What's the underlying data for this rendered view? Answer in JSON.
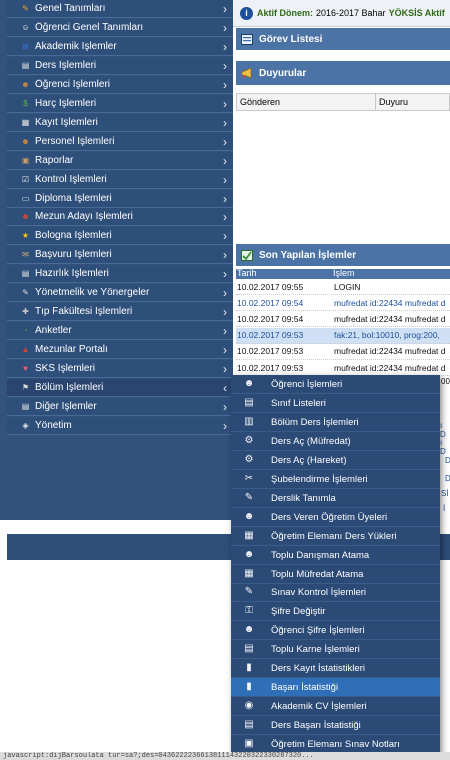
{
  "info_bar": {
    "label": "Aktif Dönem:",
    "value": "2016-2017 Bahar",
    "yoksis": "YÖKSİS Aktif",
    "icon": "info-icon"
  },
  "panels": {
    "gorev": {
      "title": "Görev Listesi",
      "icon": "task-list-icon"
    },
    "duyurular": {
      "title": "Duyurular",
      "icon": "megaphone-icon",
      "col1": "Gönderen",
      "col2": "Duyuru"
    },
    "son": {
      "title": "Son Yapılan İşlemler",
      "icon": "history-icon",
      "col1": "Tarih",
      "col2": "İşlem"
    }
  },
  "recent_rows": [
    {
      "date": "10.02.2017 09:55",
      "action": "LOGIN",
      "style": "black"
    },
    {
      "date": "10.02.2017 09:54",
      "action": "mufredat id:22434 mufredat d",
      "style": "blue"
    },
    {
      "date": "10.02.2017 09:54",
      "action": "mufredat id:22434 mufredat d",
      "style": "black"
    },
    {
      "date": "10.02.2017 09:53",
      "action": "fak:21, bol:10010, prog:200,",
      "style": "hl"
    },
    {
      "date": "10.02.2017 09:53",
      "action": "mufredat id:22434 mufredat d",
      "style": "black"
    },
    {
      "date": "10.02.2017 09:53",
      "action": "mufredat id:22434 mufredat d",
      "style": "black"
    }
  ],
  "peek": {
    "row7": "00,",
    "p1": "ı D",
    "p2": "ı D",
    "p3": "D",
    "p4": "D",
    "p5": "Sİ",
    "p6": "İ"
  },
  "sidebar": {
    "items": [
      {
        "label": "Genel Tanımları",
        "icon": "wrench-icon",
        "color": "#f0a030"
      },
      {
        "label": "Öğrenci Genel Tanımları",
        "icon": "student-icon",
        "color": "#f3f3f3"
      },
      {
        "label": "Akademik İşlemler",
        "icon": "academic-icon",
        "color": "#3a6fd0"
      },
      {
        "label": "Ders İşlemleri",
        "icon": "book-icon",
        "color": "#e8e8e8"
      },
      {
        "label": "Öğrenci İşlemleri",
        "icon": "student-group-icon",
        "color": "#c98a4a"
      },
      {
        "label": "Harç İşlemleri",
        "icon": "money-icon",
        "color": "#5fb04a"
      },
      {
        "label": "Kayıt İşlemleri",
        "icon": "register-icon",
        "color": "#e8e8e8"
      },
      {
        "label": "Personel İşlemleri",
        "icon": "personnel-icon",
        "color": "#c98a4a"
      },
      {
        "label": "Raporlar",
        "icon": "report-icon",
        "color": "#c9a06a"
      },
      {
        "label": "Kontrol İşlemleri",
        "icon": "control-icon",
        "color": "#e8e8e8"
      },
      {
        "label": "Diploma İşlemleri",
        "icon": "diploma-icon",
        "color": "#e8e8e8"
      },
      {
        "label": "Mezun Adayı İşlemleri",
        "icon": "graduate-icon",
        "color": "#c9483a"
      },
      {
        "label": "Bologna İşlemleri",
        "icon": "star-icon",
        "color": "#f2c21a"
      },
      {
        "label": "Başvuru İşlemleri",
        "icon": "application-icon",
        "color": "#d8b27a"
      },
      {
        "label": "Hazırlık İşlemleri",
        "icon": "prep-icon",
        "color": "#e8e8e8"
      },
      {
        "label": "Yönetmelik ve Yönergeler",
        "icon": "regulation-icon",
        "color": "#d9d9d9"
      },
      {
        "label": "Tıp Fakültesi İşlemleri",
        "icon": "medical-icon",
        "color": "#c9c9c9"
      },
      {
        "label": "Anketler",
        "icon": "survey-icon",
        "color": "#5a9a3a"
      },
      {
        "label": "Mezunlar Portalı",
        "icon": "alumni-icon",
        "color": "#c9483a"
      },
      {
        "label": "SKS İşlemleri",
        "icon": "heart-icon",
        "color": "#e8607a"
      },
      {
        "label": "Bölüm İşlemleri",
        "icon": "department-icon",
        "color": "#d9d9d9"
      },
      {
        "label": "Diğer İşlemler",
        "icon": "other-icon",
        "color": "#e8e8e8"
      },
      {
        "label": "Yönetim",
        "icon": "shield-icon",
        "color": "#e8e8e8"
      }
    ]
  },
  "submenu": {
    "items": [
      {
        "label": "Öğrenci İşlemleri",
        "icon": "student-search-icon"
      },
      {
        "label": "Sınıf Listeleri",
        "icon": "clipboard-icon"
      },
      {
        "label": "Bölüm Ders İşlemleri",
        "icon": "document-icon"
      },
      {
        "label": "Ders Aç (Müfredat)",
        "icon": "document-gear-icon"
      },
      {
        "label": "Ders Aç (Hareket)",
        "icon": "document-gear-icon"
      },
      {
        "label": "Şubelendirme İşlemleri",
        "icon": "branch-icon"
      },
      {
        "label": "Derslik Tanımla",
        "icon": "classroom-icon"
      },
      {
        "label": "Ders Veren Öğretim Üyeleri",
        "icon": "people-icon"
      },
      {
        "label": "Öğretim Elemanı Ders Yükleri",
        "icon": "workload-icon"
      },
      {
        "label": "Toplu Danışman Atama",
        "icon": "advisor-icon"
      },
      {
        "label": "Toplu Müfredat Atama",
        "icon": "calendar-icon"
      },
      {
        "label": "Sınav Kontrol İşlemleri",
        "icon": "exam-icon"
      },
      {
        "label": "Şifre Değiştir",
        "icon": "key-icon"
      },
      {
        "label": "Öğrenci Şifre İşlemleri",
        "icon": "student-lock-icon"
      },
      {
        "label": "Toplu Karne İşlemleri",
        "icon": "report-card-icon"
      },
      {
        "label": "Ders Kayıt İstatistikleri",
        "icon": "bar-chart-icon"
      },
      {
        "label": "Başarı İstatistiği",
        "icon": "bar-chart-icon"
      },
      {
        "label": "Akademik CV İşlemleri",
        "icon": "cv-icon"
      },
      {
        "label": "Ders Başarı İstatistiği",
        "icon": "document-chart-icon"
      },
      {
        "label": "Öğretim Elemanı Sınav Notları",
        "icon": "grades-icon"
      }
    ],
    "selected_index": 16
  },
  "status_bar": "javascript:dijBarsoulata tur=sa?;des=0436222236613811143220322330287320..."
}
